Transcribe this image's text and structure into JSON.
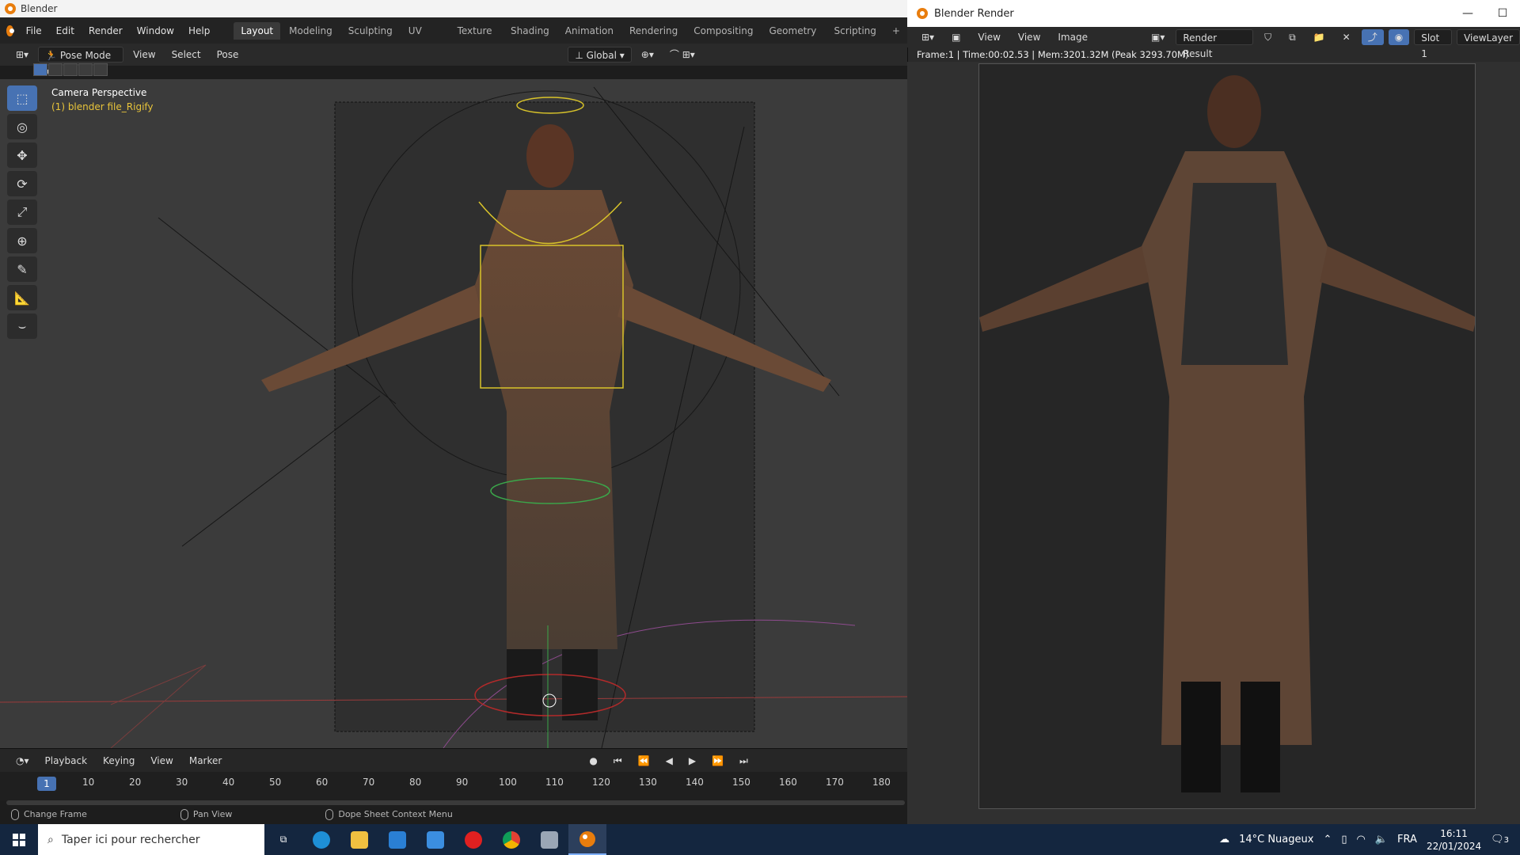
{
  "app": {
    "title": "Blender"
  },
  "menus": [
    "File",
    "Edit",
    "Render",
    "Window",
    "Help"
  ],
  "workspaces": [
    "Layout",
    "Modeling",
    "Sculpting",
    "UV Editing",
    "Texture Paint",
    "Shading",
    "Animation",
    "Rendering",
    "Compositing",
    "Geometry Nodes",
    "Scripting"
  ],
  "workspace_add": "+",
  "active_workspace": "Layout",
  "header": {
    "mode": "Pose Mode",
    "view": "View",
    "select": "Select",
    "pose": "Pose",
    "orientation": "Global"
  },
  "viewport": {
    "camera": "Camera Perspective",
    "object": "(1) blender file_Rigify"
  },
  "timeline": {
    "playback": "Playback",
    "keying": "Keying",
    "view": "View",
    "marker": "Marker",
    "current_frame": "1",
    "ticks": [
      "10",
      "20",
      "30",
      "40",
      "50",
      "60",
      "70",
      "80",
      "90",
      "100",
      "110",
      "120",
      "130",
      "140",
      "150",
      "160",
      "170",
      "180"
    ]
  },
  "status": {
    "change_frame": "Change Frame",
    "pan_view": "Pan View",
    "context_menu": "Dope Sheet Context Menu"
  },
  "render_window": {
    "title": "Blender Render",
    "view1": "View",
    "view2": "View",
    "image": "Image",
    "render_result": "Render Result",
    "slot": "Slot 1",
    "view_layer": "ViewLayer",
    "info": "Frame:1 | Time:00:02.53 | Mem:3201.32M (Peak 3293.70M)"
  },
  "taskbar": {
    "search_placeholder": "Taper ici pour rechercher",
    "weather": "14°C  Nuageux",
    "lang": "FRA",
    "time": "16:11",
    "date": "22/01/2024",
    "notifications": "3"
  },
  "colors": {
    "accent": "#4772b3",
    "blender_orange": "#e87d0d",
    "taskbar": "#14263f"
  }
}
